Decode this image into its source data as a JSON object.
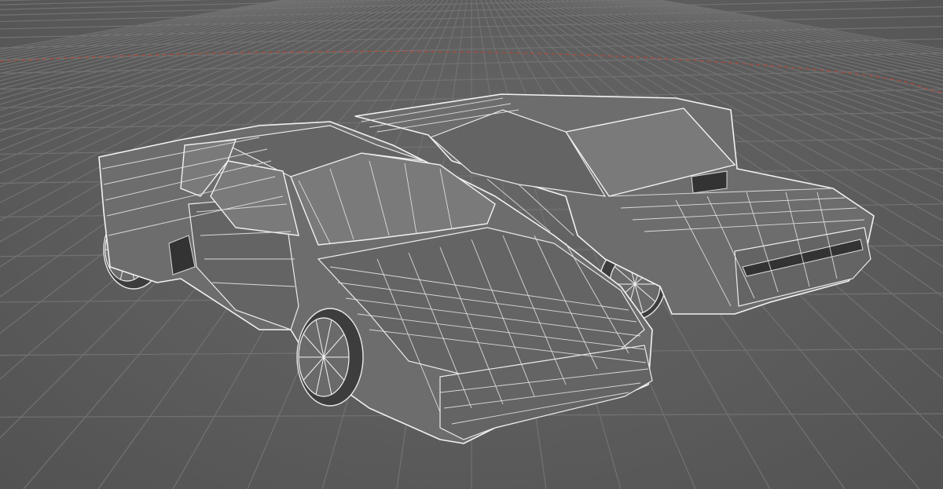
{
  "viewport": {
    "background_color": "#5b5b5b",
    "grid_color": "#727272",
    "wireframe_color": "#f2f2f2",
    "axis_color": "#b04a3a"
  },
  "scene": {
    "objects": [
      {
        "id": "sports-car",
        "kind": "car-model-wireframe"
      },
      {
        "id": "sedan-car",
        "kind": "car-model-wireframe"
      }
    ]
  }
}
